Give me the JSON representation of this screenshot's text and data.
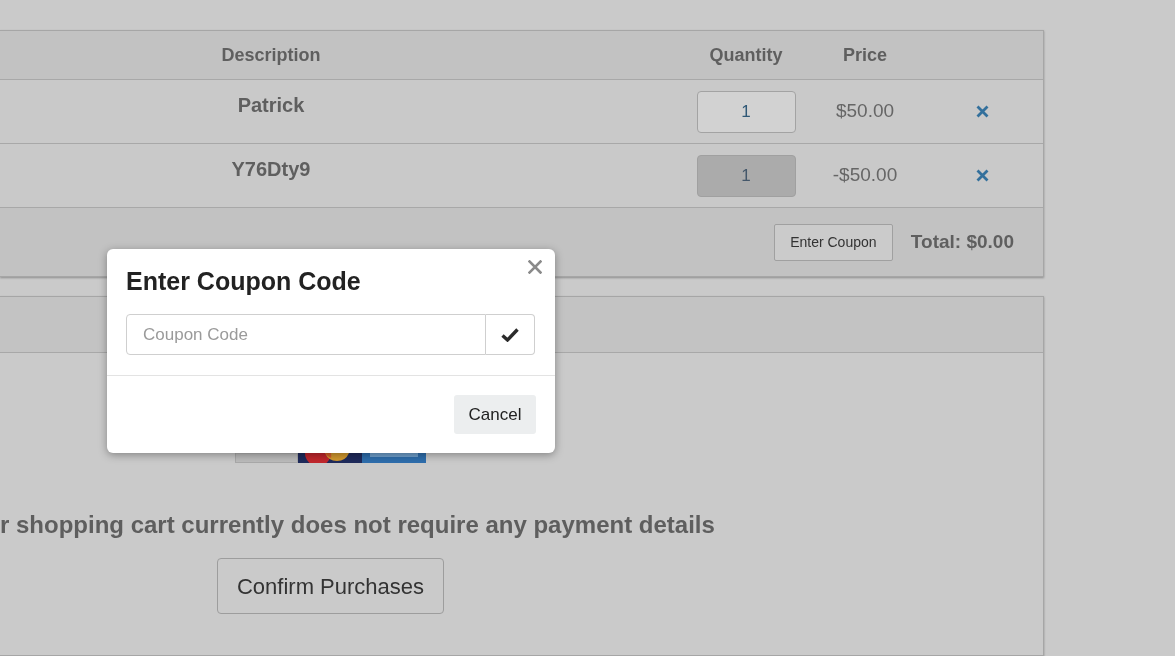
{
  "table": {
    "columns": [
      "Description",
      "Quantity",
      "Price"
    ],
    "rows": [
      {
        "description": "Patrick",
        "quantity": {
          "value": "1",
          "disabled": false
        },
        "price": "$50.00"
      },
      {
        "description": "Y76Dty9",
        "quantity": {
          "value": "1",
          "disabled": true
        },
        "price": "-$50.00"
      }
    ],
    "footer": {
      "coupon_button": "Enter Coupon",
      "total": "Total: $0.00"
    }
  },
  "payment": {
    "message": "r shopping cart currently does not require any payment details",
    "confirm_button": "Confirm Purchases"
  },
  "modal": {
    "title": "Enter Coupon Code",
    "coupon_field": {
      "placeholder": "Coupon Code"
    },
    "cancel_button": "Cancel"
  }
}
